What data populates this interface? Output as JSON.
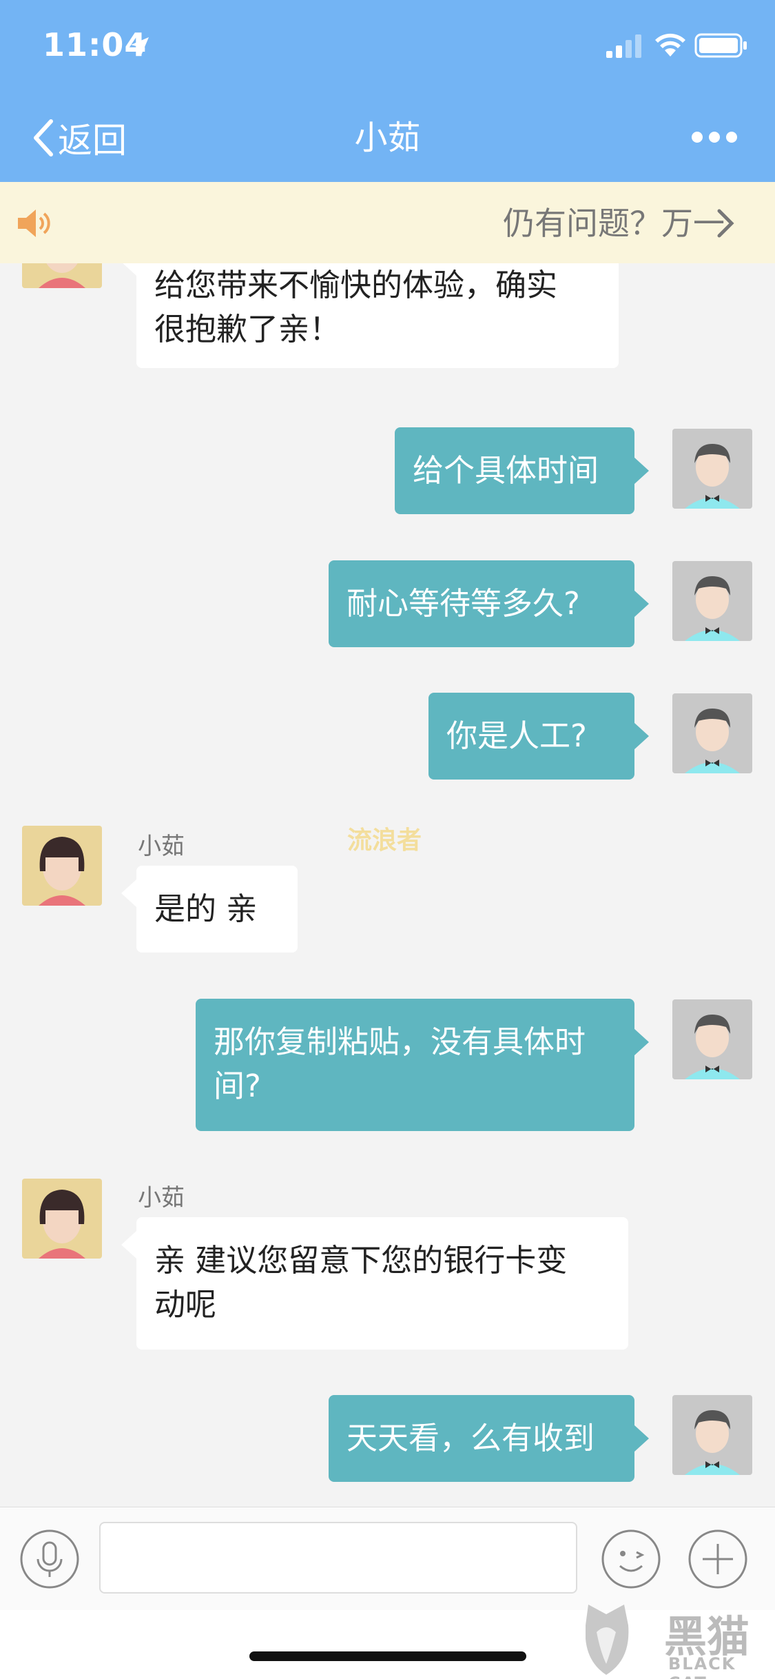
{
  "status_bar": {
    "time": "11:04"
  },
  "nav": {
    "back_label": "返回",
    "title": "小茹"
  },
  "notice": {
    "text": "仍有问题？万一"
  },
  "chat": {
    "agent_name": "小茹",
    "messages": [
      {
        "side": "left",
        "lines": [
          "给您带来不愉快的体验，确实",
          "很抱歉了亲！"
        ]
      },
      {
        "side": "right",
        "lines": [
          "给个具体时间"
        ]
      },
      {
        "side": "right",
        "lines": [
          "耐心等待等多久?"
        ]
      },
      {
        "side": "right",
        "lines": [
          "你是人工?"
        ]
      },
      {
        "side": "left",
        "sender": "小茹",
        "lines": [
          "是的 亲"
        ]
      },
      {
        "side": "right",
        "lines": [
          "那你复制粘贴，没有具体时",
          "间?"
        ]
      },
      {
        "side": "left",
        "sender": "小茹",
        "lines": [
          "亲 建议您留意下您的银行卡变",
          "动呢"
        ]
      },
      {
        "side": "right",
        "lines": [
          "天天看，么有收到"
        ]
      }
    ]
  },
  "watermark": "流浪者",
  "input": {
    "placeholder": ""
  },
  "logo": {
    "text": "黑猫",
    "subtext": "BLACK CAT"
  },
  "colors": {
    "header": "#73b4f4",
    "notice_bg": "#faf5dc",
    "bubble_right": "#5fb6c0",
    "chat_bg": "#f3f3f3"
  },
  "icons": [
    "location-arrow-icon",
    "signal-icon",
    "wifi-icon",
    "battery-icon",
    "chevron-left-icon",
    "more-icon",
    "speaker-icon",
    "chevron-right-icon",
    "microphone-icon",
    "emoji-icon",
    "plus-icon"
  ]
}
